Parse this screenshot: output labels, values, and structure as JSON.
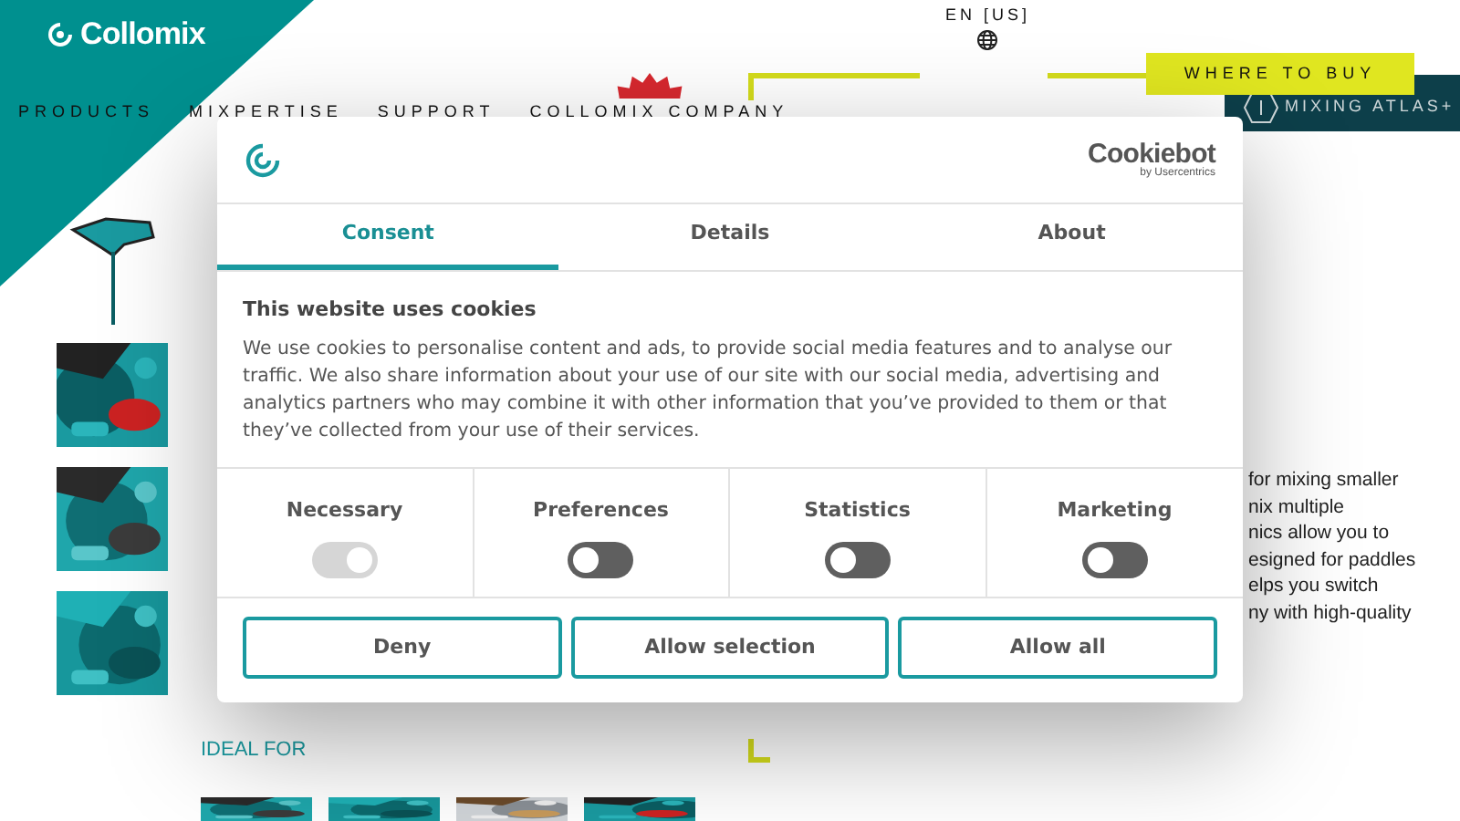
{
  "header": {
    "logo": "Collomix",
    "language": "EN [US]",
    "where_to_buy": "WHERE TO BUY",
    "mixing_atlas": "MIXING ATLAS+"
  },
  "nav": [
    {
      "label": "PRODUCTS"
    },
    {
      "label": "MIXPERTISE"
    },
    {
      "label": "SUPPORT"
    },
    {
      "label": "COLLOMIX COMPANY"
    }
  ],
  "description_lines": [
    "for mixing smaller",
    "nix multiple",
    "nics allow you to",
    "esigned for paddles",
    "elps you switch",
    "ny with high-quality"
  ],
  "ideal_for": {
    "heading": "IDEAL FOR"
  },
  "cookie_dialog": {
    "brand": "Cookiebot",
    "brand_sub": "by Usercentrics",
    "tabs": [
      {
        "label": "Consent",
        "selected": true
      },
      {
        "label": "Details",
        "selected": false
      },
      {
        "label": "About",
        "selected": false
      }
    ],
    "title": "This website uses cookies",
    "body": "We use cookies to personalise content and ads, to provide social media features and to analyse our traffic. We also share information about your use of our site with our social media, advertising and analytics partners who may combine it with other information that you’ve provided to them or that they’ve collected from your use of their services.",
    "categories": [
      {
        "label": "Necessary",
        "on": true,
        "disabled": true
      },
      {
        "label": "Preferences",
        "on": false,
        "disabled": false
      },
      {
        "label": "Statistics",
        "on": false,
        "disabled": false
      },
      {
        "label": "Marketing",
        "on": false,
        "disabled": false
      }
    ],
    "buttons": [
      {
        "label": "Deny"
      },
      {
        "label": "Allow selection"
      },
      {
        "label": "Allow all"
      }
    ]
  }
}
